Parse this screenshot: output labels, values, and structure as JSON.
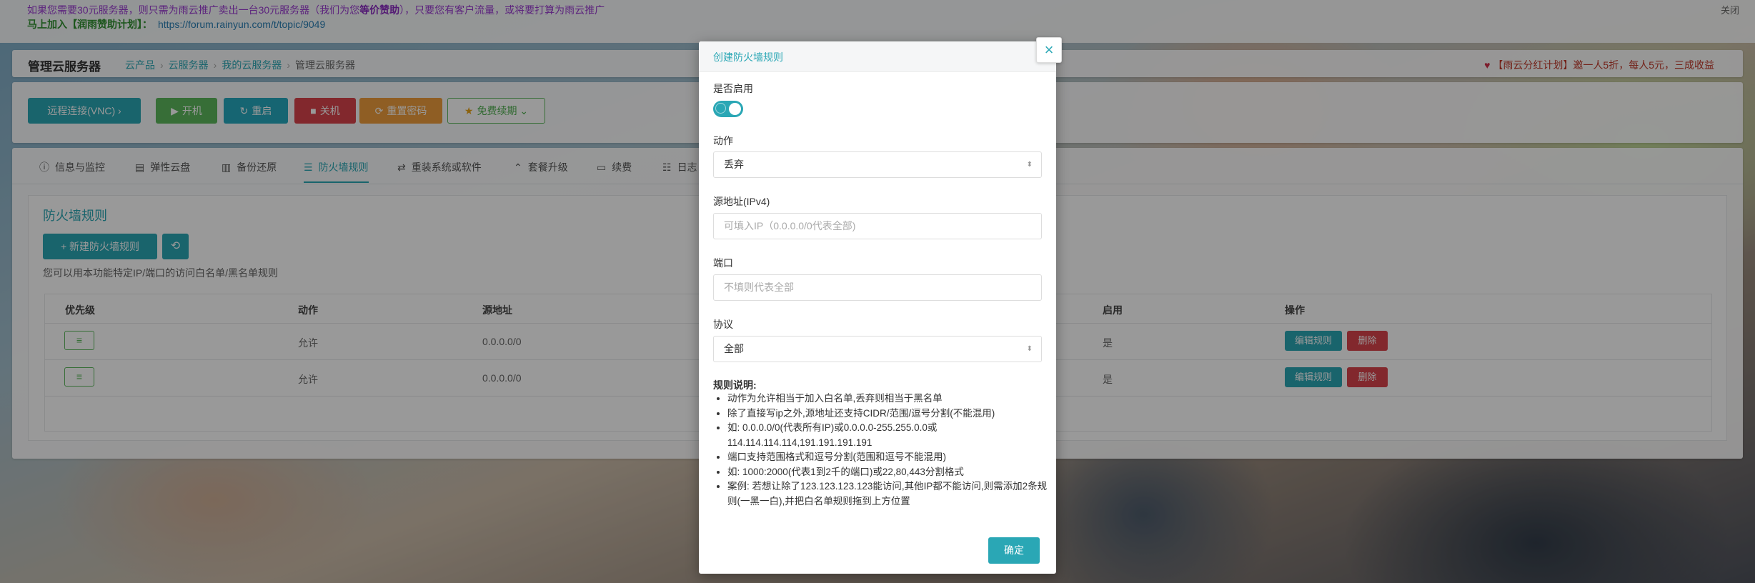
{
  "notice": {
    "line1_pre": "如果您需要30元服务器，则只需为雨云推广卖出一台30元服务器（我们为您",
    "line1_bold": "等价赞助",
    "line1_post": "），只要您有客户流量，或将要打算为雨云推广",
    "line2_label": "马上加入【润雨赞助计划】：",
    "line2_link": "https://forum.rainyun.com/t/topic/9049",
    "close": "关闭"
  },
  "header": {
    "title": "管理云服务器",
    "breadcrumb": [
      "云产品",
      "云服务器",
      "我的云服务器",
      "管理云服务器"
    ],
    "promo": "【雨云分红计划】邀一人5折，每人5元，三成收益"
  },
  "actions": {
    "vnc": "远程连接(VNC)",
    "power_on": "开机",
    "restart": "重启",
    "power_off": "关机",
    "reset_password": "重置密码",
    "free_renew": "免费续期"
  },
  "tabs": [
    {
      "label": "信息与监控",
      "icon": "info-icon"
    },
    {
      "label": "弹性云盘",
      "icon": "disk-icon"
    },
    {
      "label": "备份还原",
      "icon": "backup-icon"
    },
    {
      "label": "防火墙规则",
      "icon": "list-icon",
      "active": true
    },
    {
      "label": "重装系统或软件",
      "icon": "swap-icon"
    },
    {
      "label": "套餐升级",
      "icon": "upgrade-icon"
    },
    {
      "label": "续费",
      "icon": "card-icon"
    },
    {
      "label": "日志",
      "icon": "log-icon"
    }
  ],
  "firewall": {
    "title": "防火墙规则",
    "add_button": "+ 新建防火墙规则",
    "description": "您可以用本功能特定IP/端口的访问白名单/黑名单规则",
    "columns": {
      "priority": "优先级",
      "action": "动作",
      "source": "源地址",
      "enabled": "启用",
      "operation": "操作"
    },
    "rows": [
      {
        "action": "允许",
        "source": "0.0.0.0/0",
        "enabled": "是",
        "edit": "编辑规则",
        "delete": "删除"
      },
      {
        "action": "允许",
        "source": "0.0.0.0/0",
        "enabled": "是",
        "edit": "编辑规则",
        "delete": "删除"
      }
    ]
  },
  "modal": {
    "title": "创建防火墙规则",
    "close_symbol": "×",
    "enabled_label": "是否启用",
    "enabled": true,
    "action_label": "动作",
    "action_value": "丢弃",
    "source_label": "源地址(IPv4)",
    "source_placeholder": "可填入IP（0.0.0.0/0代表全部)",
    "port_label": "端口",
    "port_placeholder": "不填则代表全部",
    "protocol_label": "协议",
    "protocol_value": "全部",
    "rules_title": "规则说明:",
    "rules": [
      "动作为允许相当于加入白名单,丢弃则相当于黑名单",
      "除了直接写ip之外,源地址还支持CIDR/范围/逗号分割(不能混用)",
      "如: 0.0.0.0/0(代表所有IP)或0.0.0.0-255.255.0.0或114.114.114.114,191.191.191.191",
      "端口支持范围格式和逗号分割(范围和逗号不能混用)",
      "如: 1000:2000(代表1到2千的端口)或22,80,443分割格式",
      "案例: 若想让除了123.123.123.123能访问,其他IP都不能访问,则需添加2条规则(一黑一白),并把白名单规则拖到上方位置"
    ],
    "ok": "确定"
  },
  "colors": {
    "accent": "#2aa7b5",
    "danger": "#d9434b",
    "success": "#5cb85c",
    "warning": "#ef9d3c"
  }
}
